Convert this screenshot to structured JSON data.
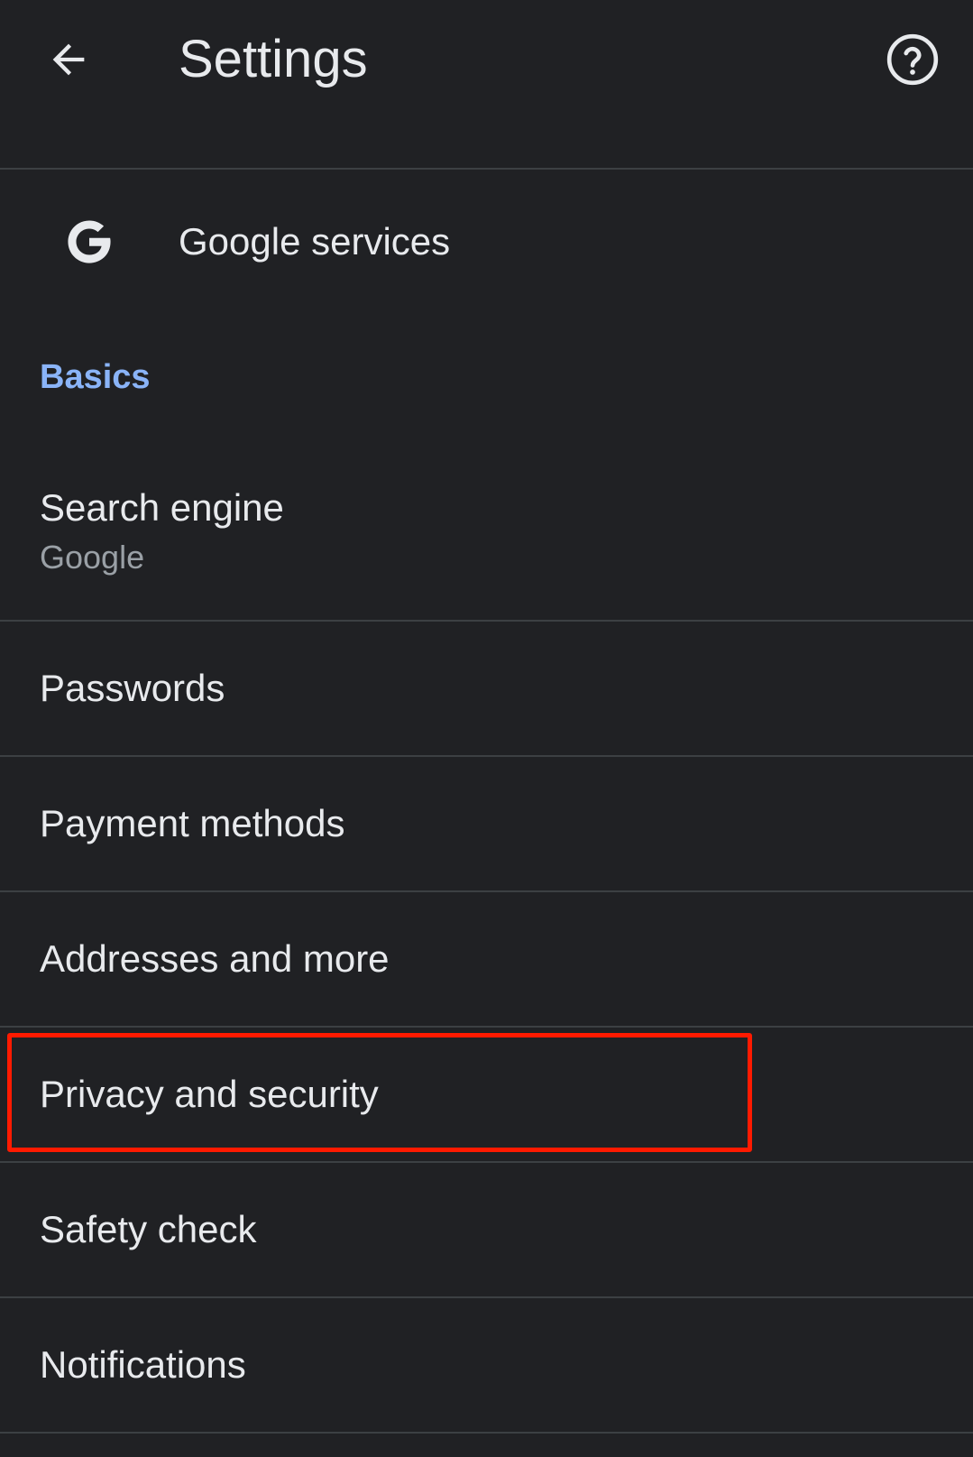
{
  "header": {
    "title": "Settings",
    "back_icon": "arrow-back-icon",
    "help_icon": "help-circle-icon"
  },
  "google_services": {
    "label": "Google services",
    "icon": "google-g-icon"
  },
  "basics": {
    "header": "Basics",
    "items": [
      {
        "label": "Search engine",
        "summary": "Google"
      },
      {
        "label": "Passwords"
      },
      {
        "label": "Payment methods"
      },
      {
        "label": "Addresses and more"
      },
      {
        "label": "Privacy and security"
      },
      {
        "label": "Safety check"
      },
      {
        "label": "Notifications"
      }
    ]
  },
  "colors": {
    "background": "#202124",
    "text_primary": "#e8eaed",
    "text_secondary": "#9aa0a6",
    "section_accent": "#8ab4f8",
    "divider": "#3c4043",
    "highlight": "#ff1a00"
  }
}
